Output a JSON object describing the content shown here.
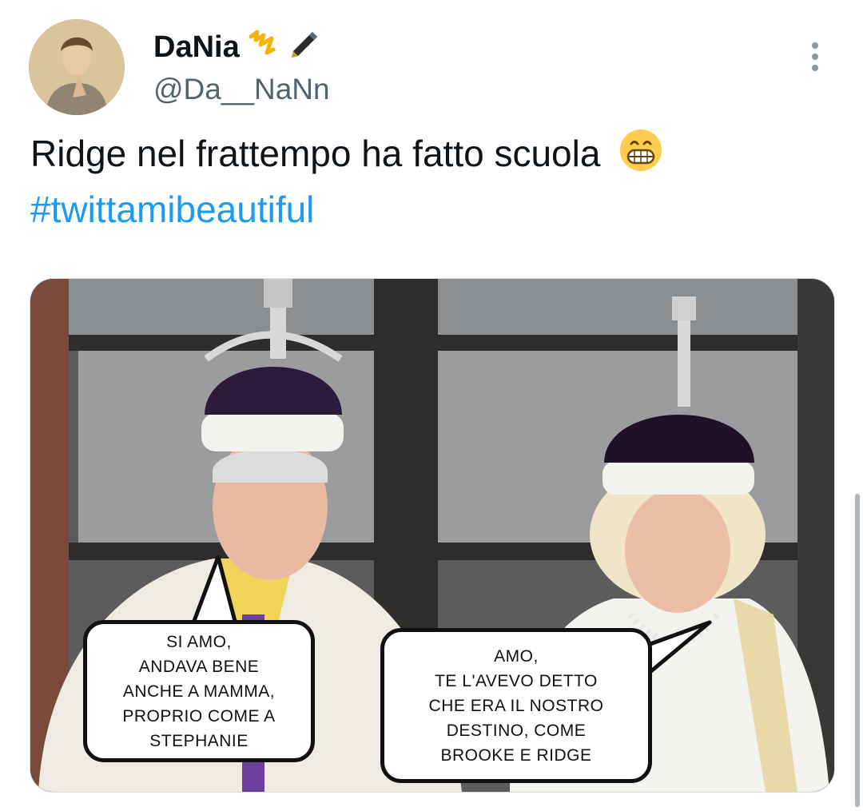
{
  "user": {
    "display_name": "DaNia",
    "handle": "@Da__NaNn",
    "badge_icons": [
      "scroll-icon",
      "pen-icon"
    ]
  },
  "tweet": {
    "text": "Ridge nel frattempo ha fatto scuola",
    "emoji": "grinning-face-emoji",
    "hashtag": "#twittamibeautiful"
  },
  "media": {
    "bubble_left": "SI AMO,\nANDAVA BENE\nANCHE A MAMMA,\nPROPRIO COME A\nSTEPHANIE",
    "bubble_right": "AMO,\nTE L'AVEVO DETTO\nCHE ERA IL NOSTRO\nDESTINO, COME\nBROOKE E RIDGE"
  },
  "colors": {
    "link": "#1d9bf0",
    "text": "#0f1419",
    "muted": "#536471"
  }
}
